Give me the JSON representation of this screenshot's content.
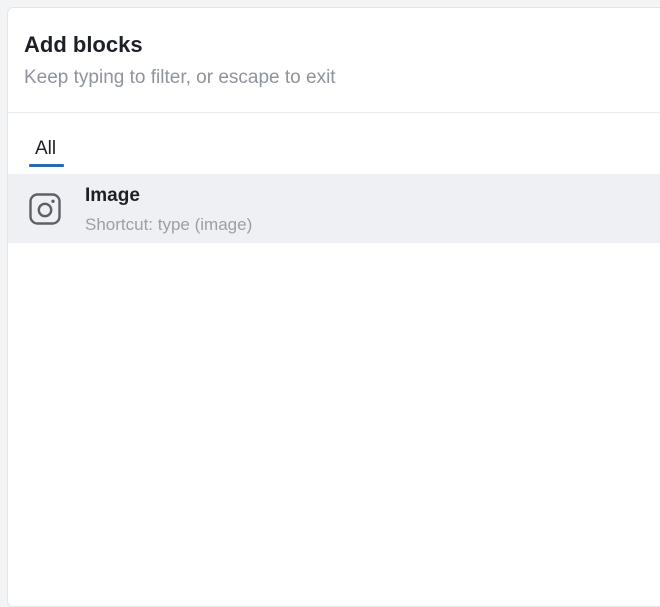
{
  "modal": {
    "title": "Add blocks",
    "subtitle": "Keep typing to filter, or escape to exit"
  },
  "tabs": [
    {
      "label": "All",
      "selected": true
    }
  ],
  "blocks": [
    {
      "name": "Image",
      "shortcut": "Shortcut: type (image)",
      "icon": "image-icon",
      "highlighted": true
    }
  ],
  "colors": {
    "accent": "#2a6bb0",
    "row_highlight": "#eef0f3",
    "title_text": "#1d2127",
    "muted_text": "#8e949c"
  }
}
